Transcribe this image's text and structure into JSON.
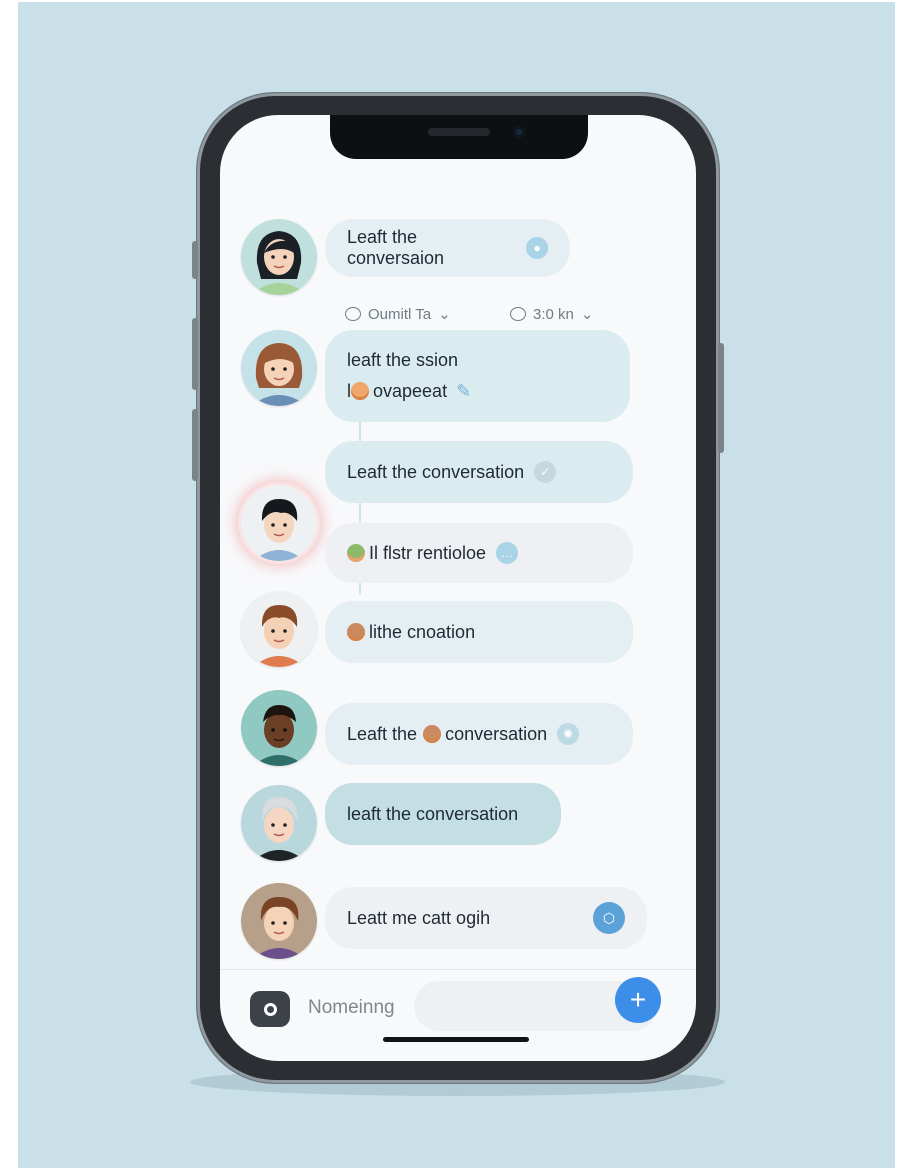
{
  "colors": {
    "backdrop": "#c9e0e8",
    "send_button": "#3c8ee8",
    "bubble_light": "#e4eef3",
    "bubble_teal": "#c3dfe4"
  },
  "chat": {
    "messages": [
      {
        "text": "Leaft the conversaion",
        "icon": "chat-bubble-icon"
      },
      {
        "text_line1": "leaft the ssion",
        "text_line2": "l",
        "text_line2b": "ovapeeat",
        "icon": "pencil-icon"
      },
      {
        "text": "Leaft the conversation",
        "icon": "check-bubble-icon"
      },
      {
        "text_a": "Il flstr rentioloe",
        "icon": "chat-dots-icon"
      },
      {
        "text": "lithe cnoation"
      },
      {
        "text_a": "Leaft the",
        "text_b": "conversation",
        "icon": "sparkle-icon"
      },
      {
        "text": "leaft the conversation"
      },
      {
        "text": "Leatt me catt ogih",
        "icon": "shield-icon"
      }
    ],
    "meta": [
      {
        "label": "Oumitl Ta",
        "icon": "comment-icon"
      },
      {
        "label": "3:0 kn",
        "icon": "comment-icon"
      }
    ]
  },
  "composer": {
    "label": "Nomeinng",
    "send_symbol": "+"
  }
}
